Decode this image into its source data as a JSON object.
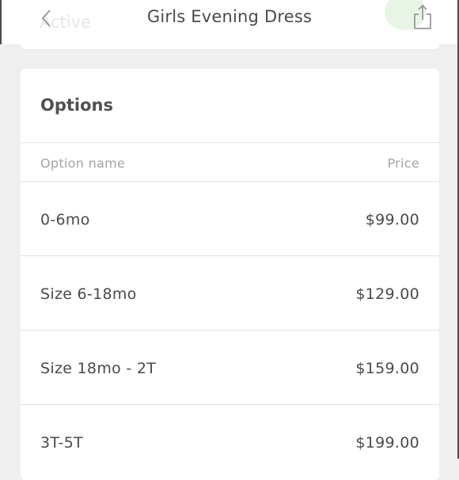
{
  "header": {
    "title": "Girls Evening Dress",
    "ghost_status": "Active"
  },
  "options": {
    "heading": "Options",
    "column_name": "Option name",
    "column_price": "Price",
    "rows": [
      {
        "name": "0-6mo",
        "price": "$99.00"
      },
      {
        "name": "Size 6-18mo",
        "price": "$129.00"
      },
      {
        "name": "Size 18mo - 2T",
        "price": "$159.00"
      },
      {
        "name": "3T-5T",
        "price": "$199.00"
      }
    ]
  },
  "colors": {
    "background": "#efefef",
    "card": "#ffffff",
    "text": "#4a4a4a",
    "muted": "#a4a4a4",
    "divider": "#e2e2e2"
  }
}
